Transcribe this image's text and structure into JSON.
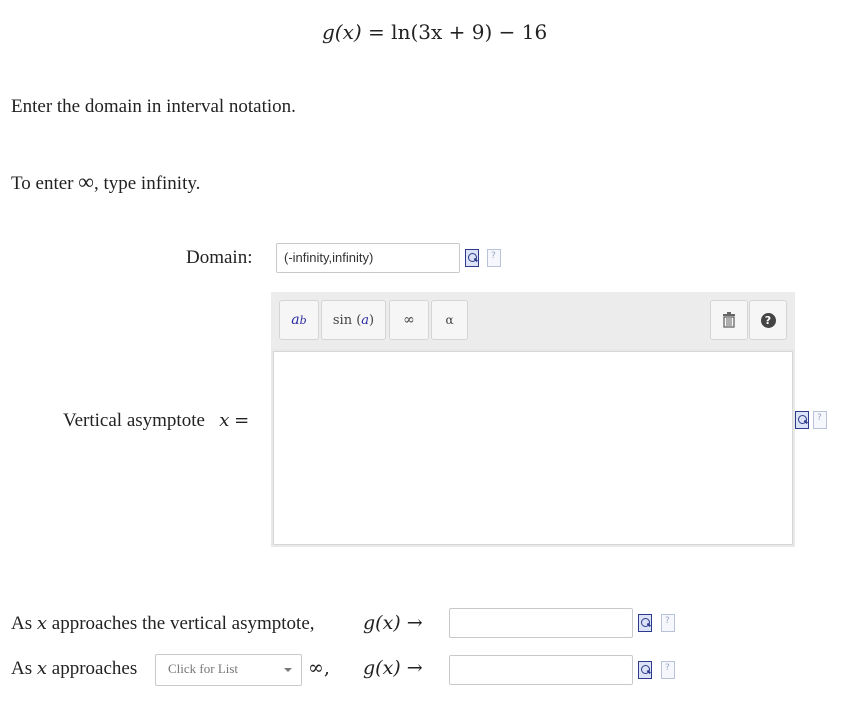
{
  "problem": {
    "equation_lhs": "g(x)",
    "equation_rhs": "ln(3x + 9) − 16",
    "instruction_domain": "Enter the domain in interval notation.",
    "instruction_infinity_prefix": "To enter",
    "instruction_infinity_symbol": "∞",
    "instruction_infinity_suffix": ", type infinity."
  },
  "domain": {
    "label": "Domain:",
    "value": "(-infinity,infinity)"
  },
  "asymptote": {
    "label": "Vertical asymptote",
    "var": "x",
    "eq": "="
  },
  "toolbar": {
    "power_label_base": "a",
    "power_label_exp": "b",
    "sin_label": "sin",
    "sin_arg": "a",
    "infinity_label": "∞",
    "alpha_label": "α",
    "help_label": "?"
  },
  "behavior": {
    "row1_prefix": "As",
    "row1_var": "x",
    "row1_suffix": "approaches the vertical asymptote,",
    "row2_prefix": "As",
    "row2_var": "x",
    "row2_mid": "approaches",
    "select_placeholder": "Click for List",
    "row2_after": "∞,",
    "gx": "g(x)",
    "arrow": "→"
  }
}
